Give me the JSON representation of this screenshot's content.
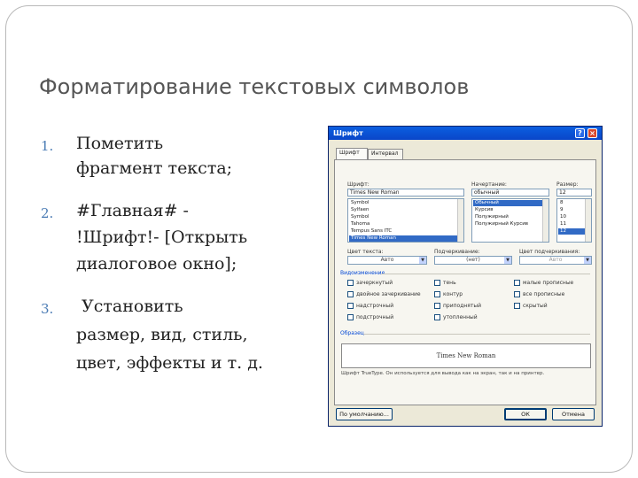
{
  "slide": {
    "title": "Форматирование текстовых символов",
    "items": [
      {
        "num": "1.",
        "lines": [
          "Пометить",
          "фрагмент текста;"
        ]
      },
      {
        "num": "2.",
        "lines": [
          "#Главная# -",
          "!Шрифт!- [Открыть",
          "диалоговое окно];"
        ]
      },
      {
        "num": "3.",
        "lines": [
          " Установить",
          "размер, вид, стиль,",
          "цвет, эффекты и т. д."
        ]
      }
    ]
  },
  "dialog": {
    "title": "Шрифт",
    "help_glyph": "?",
    "close_glyph": "×",
    "tabs": [
      "Шрифт",
      "Интервал"
    ],
    "font_label": "Шрифт:",
    "font_value": "Times New Roman",
    "font_list": [
      "Symbol",
      "Sylfaen",
      "Symbol",
      "Tahoma",
      "Tempus Sans ITC",
      "Times New Roman"
    ],
    "style_label": "Начертание:",
    "style_value": "обычный",
    "style_list": [
      "Обычный",
      "Курсив",
      "Полужирный",
      "Полужирный Курсив"
    ],
    "size_label": "Размер:",
    "size_value": "12",
    "size_list": [
      "8",
      "9",
      "10",
      "11",
      "12"
    ],
    "color_label": "Цвет текста:",
    "color_value": "Авто",
    "underline_label": "Подчеркивание:",
    "underline_value": "(нет)",
    "underline_color_label": "Цвет подчеркивания:",
    "underline_color_value": "Авто",
    "effects_label": "Видоизменение",
    "effects": [
      "зачеркнутый",
      "тень",
      "малые прописные",
      "двойное зачеркивание",
      "контур",
      "все прописные",
      "надстрочный",
      "приподнятый",
      "скрытый",
      "подстрочный",
      "утопленный"
    ],
    "preview_label": "Образец",
    "preview_text": "Times New Roman",
    "preview_note": "Шрифт TrueType. Он используется для вывода как на экран, так и на принтер.",
    "default_button": "По умолчанию...",
    "ok_button": "ОК",
    "cancel_button": "Отмена"
  }
}
